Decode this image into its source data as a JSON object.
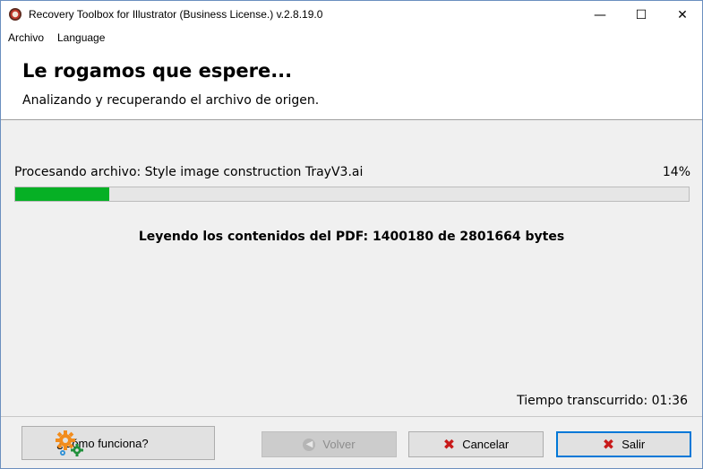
{
  "window": {
    "title": "Recovery Toolbox for Illustrator (Business License.) v.2.8.19.0",
    "minimize": "—",
    "maximize": "☐",
    "close": "✕"
  },
  "menu": [
    "Archivo",
    "Language"
  ],
  "header": {
    "title": "Le rogamos que espere...",
    "subtitle": "Analizando y recuperando el archivo de origen."
  },
  "progress": {
    "label": "Procesando archivo: Style image construction TrayV3.ai",
    "percent_text": "14%",
    "percent": 14,
    "fill_color": "#06b025"
  },
  "status": "Leyendo los contenidos del PDF: 1400180 de 2801664 bytes",
  "elapsed": "Tiempo transcurrido: 01:36",
  "buttons": {
    "help": "¿Cómo funciona?",
    "back": "Volver",
    "cancel": "Cancelar",
    "exit": "Salir"
  },
  "icons": {
    "app": "app-icon",
    "help": "gears-icon",
    "back": "back-arrow-icon",
    "cancel": "x-icon",
    "exit": "x-icon"
  }
}
